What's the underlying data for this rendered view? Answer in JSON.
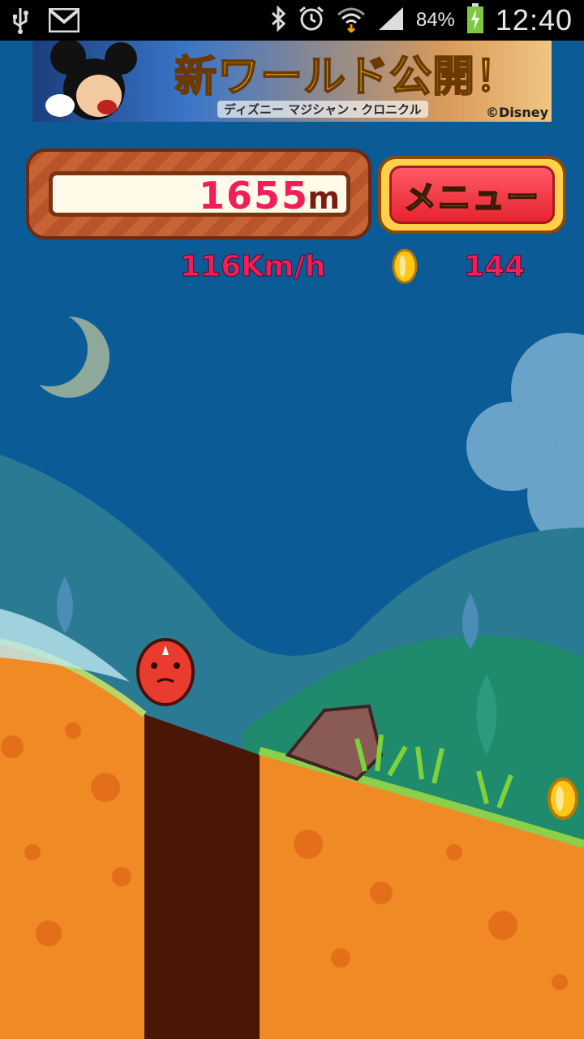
{
  "status_bar": {
    "battery": "84%",
    "time": "12:40",
    "icons": [
      "usb-icon",
      "gmail-icon",
      "bluetooth-icon",
      "alarm-icon",
      "wifi-icon",
      "signal-icon",
      "battery-charging-icon"
    ]
  },
  "ad_banner": {
    "title": "新ワールド公開！",
    "subtitle": "ディズニー マジシャン・クロニクル",
    "copyright": "©Disney"
  },
  "hud": {
    "distance_value": "1655",
    "distance_unit": "m",
    "menu_label": "メニュー",
    "speed": "116Km/h",
    "coins": "144"
  },
  "colors": {
    "accent_text": "#ee1f5a",
    "sky": "#0b5b96",
    "ground": "#f08a24",
    "pit": "#4a1606",
    "menu_button": "#e7242f"
  }
}
